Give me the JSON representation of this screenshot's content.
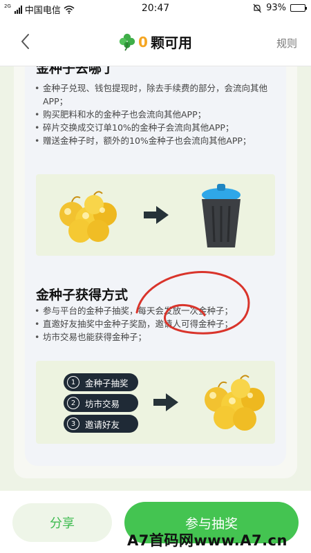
{
  "status_bar": {
    "network_sup": "2G",
    "carrier": "中国电信",
    "time": "20:47",
    "battery": "93%",
    "battery_level": 0.93
  },
  "header": {
    "count": "0",
    "title": "颗可用",
    "rules": "规则",
    "icons": {
      "back": "back-icon",
      "clover": "clover-icon"
    }
  },
  "section1": {
    "title": "金种子去哪了",
    "bullets": [
      "金种子兑现、钱包提现时，除去手续费的部分，会流向其他APP；",
      "购买肥料和水的金种子也会流向其他APP；",
      "碎片交换成交订单10%的金种子会流向其他APP；",
      "赠送金种子时，额外的10%金种子也会流向其他APP；"
    ]
  },
  "section2": {
    "title": "金种子获得方式",
    "bullets": [
      "参与平台的金种子抽奖，每天会发放一次金种子；",
      "直邀好友抽奖中金种子奖励，邀请人可得金种子；",
      "坊市交易也能获得金种子；"
    ],
    "steps": [
      {
        "num": "1",
        "label": "金种子抽奖"
      },
      {
        "num": "2",
        "label": "坊市交易"
      },
      {
        "num": "3",
        "label": "邀请好友"
      }
    ]
  },
  "bottom": {
    "share": "分享",
    "join": "参与抽奖"
  },
  "watermark": "A7首码网www.A7.cn",
  "colors": {
    "accent_green": "#44c451",
    "count_orange": "#f5a623",
    "bin_lid_blue": "#2fa7e8",
    "scribble_red": "#d9342b"
  }
}
